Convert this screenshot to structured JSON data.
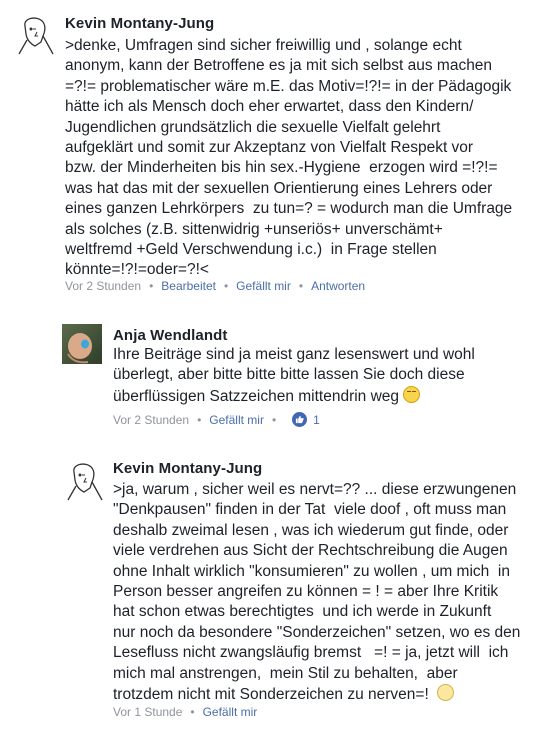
{
  "comments": [
    {
      "author": "Kevin Montany-Jung",
      "avatar_icon": "sketch-face-icon",
      "text": ">denke, Umfragen sind sicher freiwillig und , solange echt\nanonym, kann der Betroffene es ja mit sich selbst aus machen\n=?!= problematischer wäre m.E. das Motiv=!?!= in der Pädagogik\nhätte ich als Mensch doch eher erwartet, dass den Kindern/\nJugendlichen grundsätzlich die sexuelle Vielfalt gelehrt\naufgeklärt und somit zur Akzeptanz von Vielfalt Respekt vor\nbzw. der Minderheiten bis hin sex.-Hygiene  erzogen wird =!?!=\nwas hat das mit der sexuellen Orientierung eines Lehrers oder\neines ganzen Lehrkörpers  zu tun=? = wodurch man die Umfrage\nals solches (z.B. sittenwidrig +unseriös+ unverschämt+\nweltfremd +Geld Verschwendung i.c.)  in Frage stellen\nkönnte=!?!=oder=?!<",
      "time": "Vor 2 Stunden",
      "edited": "Bearbeitet",
      "like": "Gefällt mir",
      "reply": "Antworten"
    },
    {
      "author": "Anja Wendlandt",
      "avatar_icon": "photo-avatar-icon",
      "text": "Ihre Beiträge sind ja meist ganz lesenswert und wohl\nüberlegt, aber bitte bitte bitte lassen Sie doch diese\nüberflüssigen Satzzeichen mittendrin weg ",
      "emoji": "grimace-emoji",
      "time": "Vor 2 Stunden",
      "like": "Gefällt mir",
      "like_count": "1"
    },
    {
      "author": "Kevin Montany-Jung",
      "avatar_icon": "sketch-face-icon",
      "text": ">ja, warum , sicher weil es nervt=?? ... diese erzwungenen\n\"Denkpausen\" finden in der Tat  viele doof , oft muss man\ndeshalb zweimal lesen , was ich wiederum gut finde, oder\nviele verdrehen aus Sicht der Rechtschreibung die Augen\nohne Inhalt wirklich \"konsumieren\" zu wollen , um mich  in\nPerson besser angreifen zu können = ! = aber Ihre Kritik\nhat schon etwas berechtigtes  und ich werde in Zukunft\nnur noch da besondere \"Sonderzeichen\" setzen, wo es den\nLesefluss nicht zwangsläufig bremst   =! = ja, jetzt will  ich\nmich mal anstrengen,  mein Stil zu behalten,  aber\ntrotzdem nicht mit Sonderzeichen zu nerven=!  ",
      "emoji": "wink-emoji",
      "time": "Vor 1 Stunde",
      "like": "Gefällt mir"
    }
  ],
  "colors": {
    "text": "#1d2129",
    "meta": "#90949c",
    "link": "#4b6ea8",
    "like_badge": "#4267b2"
  }
}
